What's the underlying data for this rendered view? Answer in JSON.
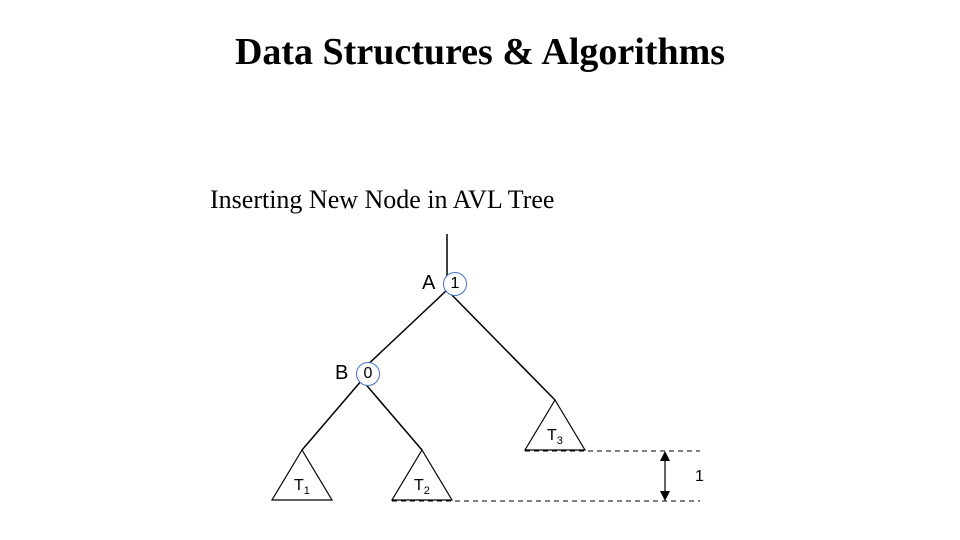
{
  "title": "Data Structures & Algorithms",
  "subtitle": "Inserting New Node in AVL Tree",
  "diagram": {
    "nodeA": {
      "label": "A",
      "balance": "1"
    },
    "nodeB": {
      "label": "B",
      "balance": "0"
    },
    "subtrees": {
      "t1": {
        "name": "T",
        "index": "1"
      },
      "t2": {
        "name": "T",
        "index": "2"
      },
      "t3": {
        "name": "T",
        "index": "3"
      }
    },
    "heightMarker": "1",
    "colors": {
      "circleStroke": "#4472c4",
      "line": "#000000"
    }
  }
}
